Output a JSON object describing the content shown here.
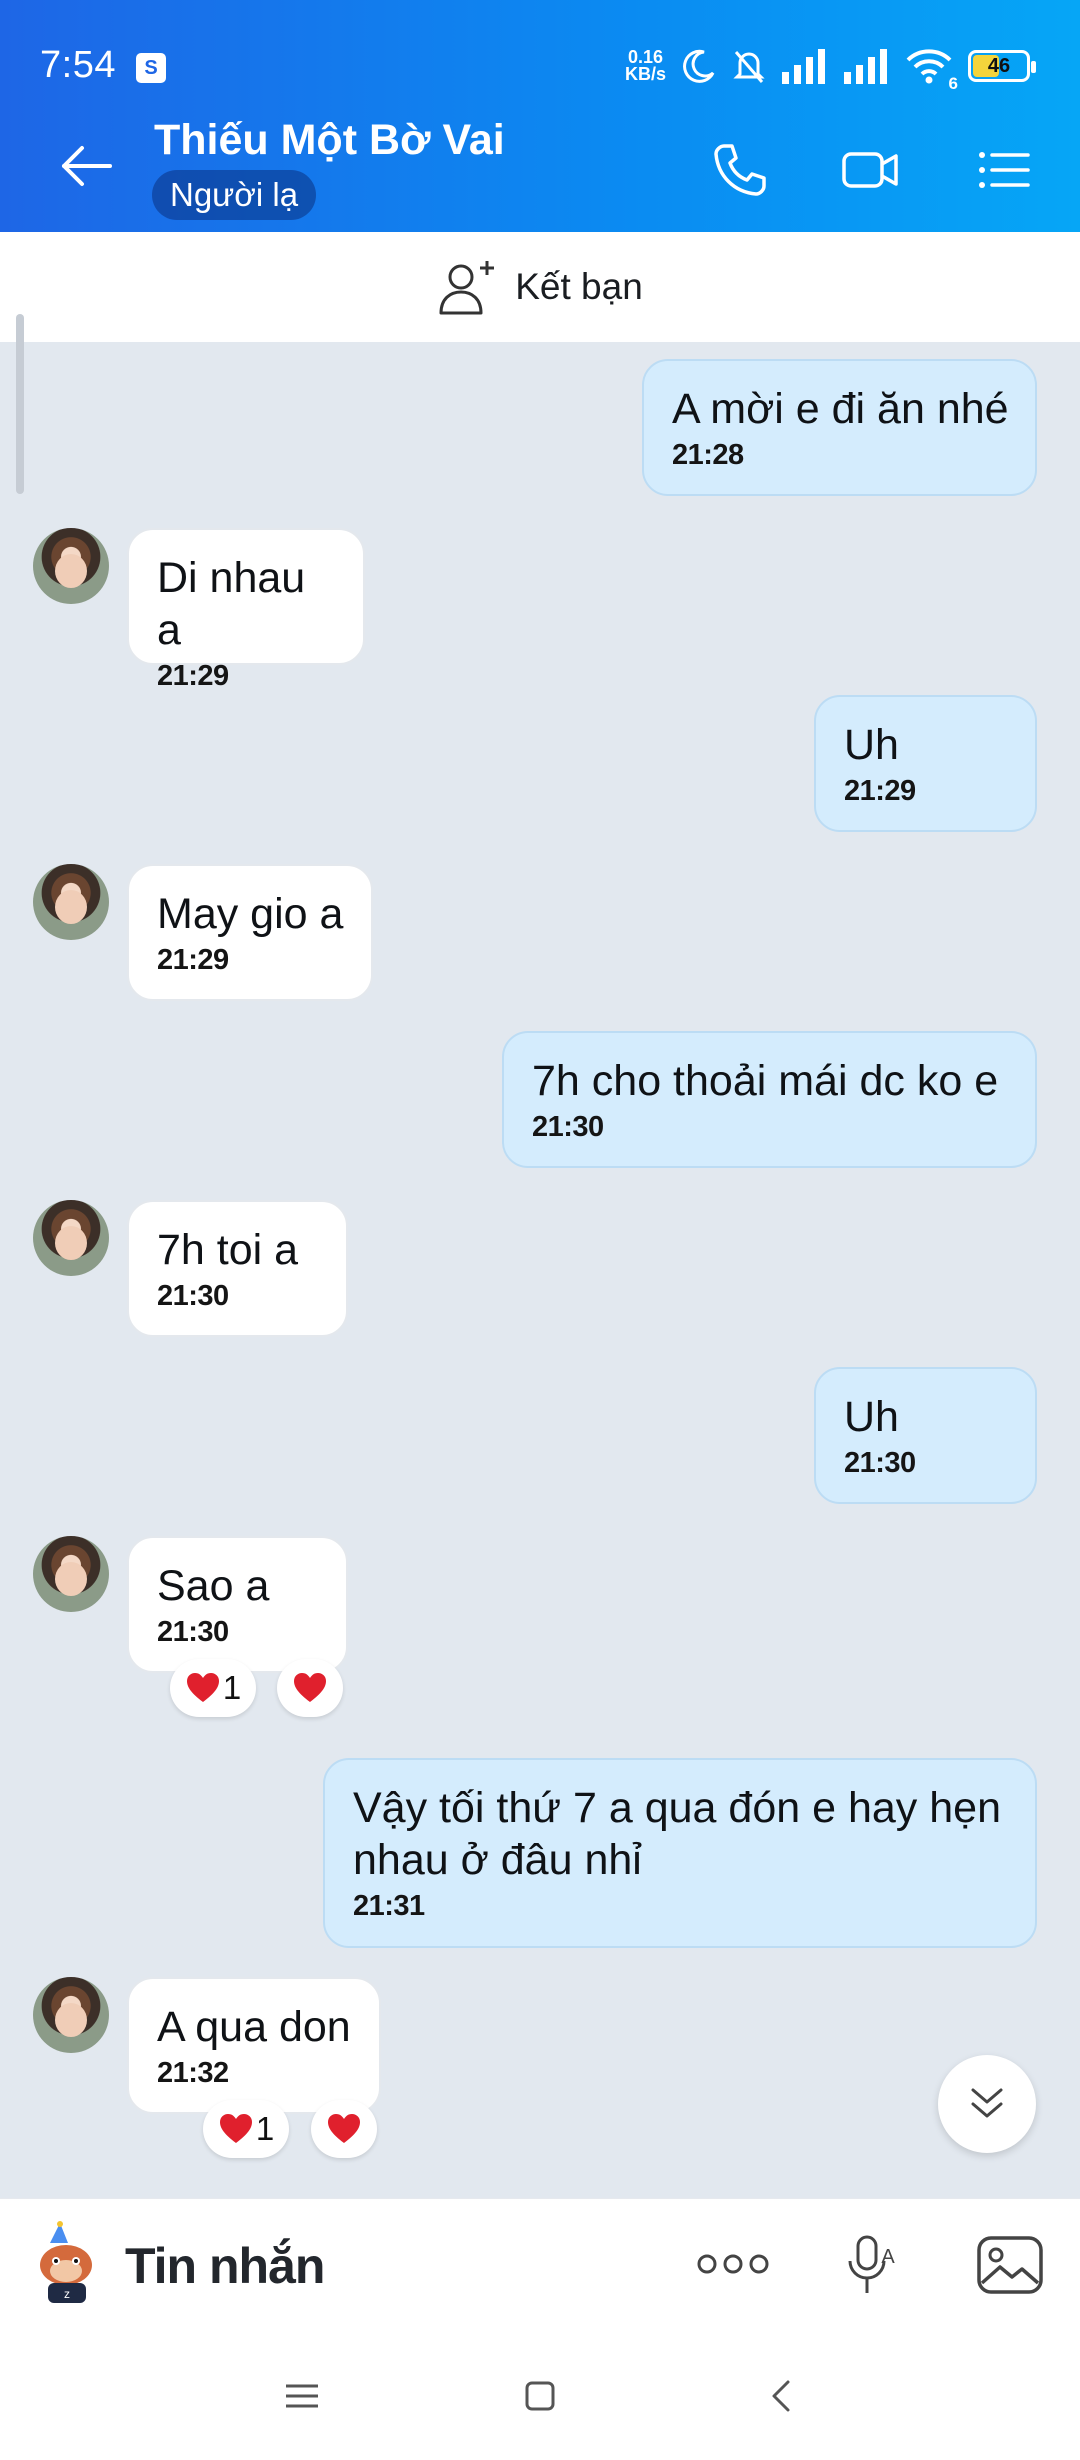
{
  "status": {
    "time": "7:54",
    "shop_icon": "S",
    "net_speed_value": "0.16",
    "net_speed_unit": "KB/s",
    "wifi_badge": "6",
    "battery": "46",
    "battery_level": 0.46
  },
  "header": {
    "name": "Thiếu Một Bờ Vai",
    "tag": "Người lạ",
    "back_icon": "back-arrow-icon",
    "call_icon": "phone-icon",
    "video_icon": "video-camera-icon",
    "menu_icon": "list-menu-icon"
  },
  "add_friend": {
    "label": "Kết bạn"
  },
  "messages": [
    {
      "dir": "out",
      "text": "A mời e đi ăn nhé",
      "time": "21:28"
    },
    {
      "dir": "in",
      "text": "Di nhau a",
      "time": "21:29"
    },
    {
      "dir": "out",
      "text": "Uh",
      "time": "21:29"
    },
    {
      "dir": "in",
      "text": "May gio a",
      "time": "21:29"
    },
    {
      "dir": "out",
      "text": "7h cho thoải mái dc ko e",
      "time": "21:30"
    },
    {
      "dir": "in",
      "text": "7h toi a",
      "time": "21:30"
    },
    {
      "dir": "out",
      "text": "Uh",
      "time": "21:30"
    },
    {
      "dir": "in",
      "text": "Sao a",
      "time": "21:30",
      "reaction_count": "1"
    },
    {
      "dir": "out",
      "text": "Vậy tối thứ 7 a qua đón e hay hẹn nhau ở đâu nhỉ",
      "time": "21:31"
    },
    {
      "dir": "in",
      "text": "A qua don",
      "time": "21:32",
      "reaction_count": "1"
    }
  ],
  "composer": {
    "placeholder": "Tin nhắn",
    "more_icon": "more-dots-icon",
    "mic_icon": "voice-to-text-icon",
    "image_icon": "image-icon"
  },
  "colors": {
    "header_start": "#1e66e6",
    "header_end": "#06a6f6",
    "outgoing_bubble": "#d4ecfd",
    "incoming_bubble": "#ffffff",
    "chat_background": "#e2e8ef",
    "heart": "#e0202d"
  }
}
